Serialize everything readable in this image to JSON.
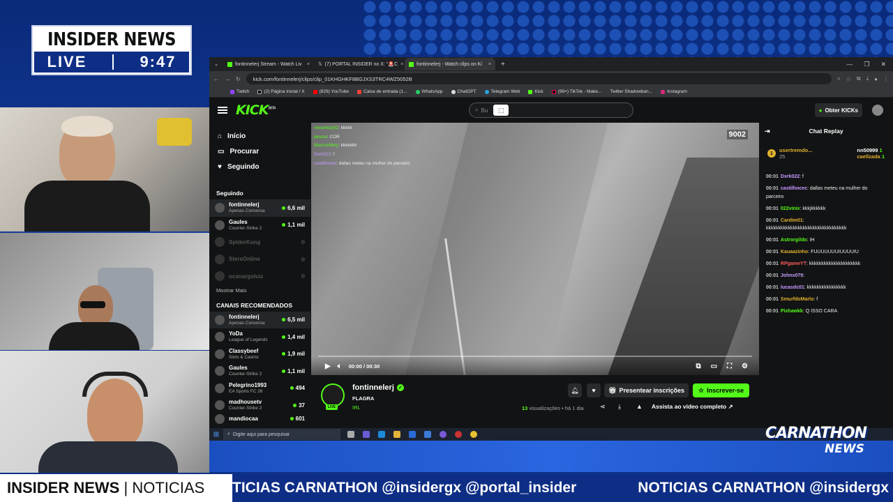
{
  "badge": {
    "title": "INSIDER NEWS",
    "live": "LIVE",
    "time": "9:47"
  },
  "browser": {
    "tabs": [
      {
        "label": "fontinnelerj Stream - Watch Liv",
        "close": "×"
      },
      {
        "label": "(7) PORTAL INSIDER no X: \"🚨C",
        "close": "×"
      },
      {
        "label": "fontinnelerj - Watch clips on Ki",
        "close": "×"
      }
    ],
    "new_tab": "+",
    "url": "kick.com/fontinnelerj/clips/clip_01KHGHKF8BGJXS3TRC4WZ5052B",
    "bookmarks": [
      "Twitch",
      "(2) Página Inicial / X",
      "(829) YouTube",
      "Caixa de entrada (1...",
      "WhatsApp",
      "ChatGPT",
      "Telegram Web",
      "Kick",
      "(99+) TikTok - Make...",
      "Twitter Shadowban...",
      "Instagram"
    ]
  },
  "kick": {
    "logo": "KICK",
    "logo_sup": "BETA",
    "search_placeholder": "Bu",
    "get_kicks": "Obter KICKs",
    "nav": [
      {
        "label": "Início",
        "icon": "home-icon"
      },
      {
        "label": "Procurar",
        "icon": "browse-icon"
      },
      {
        "label": "Seguindo",
        "icon": "heart-icon"
      }
    ],
    "following_title": "Seguindo",
    "following": [
      {
        "name": "fontinnelerj",
        "cat": "Apenas Conversa",
        "viewers": "6,6 mil",
        "on": true
      },
      {
        "name": "Gaules",
        "cat": "Counter-Strike 2",
        "viewers": "1,1 mil",
        "on": true
      },
      {
        "name": "SpiderKong",
        "cat": "",
        "viewers": "",
        "on": false
      },
      {
        "name": "StereOnline",
        "cat": "",
        "viewers": "",
        "on": false
      },
      {
        "name": "ocanargoluiz",
        "cat": "",
        "viewers": "",
        "on": false
      }
    ],
    "show_more": "Mostrar Mais",
    "recommended_title": "CANAIS RECOMENDADOS",
    "recommended": [
      {
        "name": "fontinnelerj",
        "cat": "Apenas Conversa",
        "viewers": "6,5 mil"
      },
      {
        "name": "YoDa",
        "cat": "League of Legends",
        "viewers": "1,4 mil"
      },
      {
        "name": "Classybeef",
        "cat": "Slots & Casino",
        "viewers": "1,9 mil"
      },
      {
        "name": "Gaules",
        "cat": "Counter-Strike 2",
        "viewers": "1,1 mil"
      },
      {
        "name": "Pelegrino1993",
        "cat": "EA Sports FC 26",
        "viewers": "494"
      },
      {
        "name": "madhousetv",
        "cat": "Counter-Strike 2",
        "viewers": "37"
      },
      {
        "name": "mandiocaa",
        "cat": "",
        "viewers": "601"
      }
    ],
    "video": {
      "viewer_count": "9002",
      "time": "00:00 / 00:30",
      "progress": 0,
      "overlay_chat": [
        {
          "user": "vincentarj02",
          "text": ": kkkkk"
        },
        {
          "user": "jaoxsa",
          "text": ": COR"
        },
        {
          "user": "MarcosNery",
          "text": ": kkkkkkk"
        },
        {
          "user": "Dxrk022",
          "text": ": f"
        },
        {
          "user": "castilhocec",
          "text": ": dallas meteu na mulher do parceiro"
        }
      ]
    },
    "channel": {
      "name": "fontinnelerj",
      "title": "FLAGRA",
      "category": "IRL",
      "live": "LIVE",
      "gift_label": "Presentear inscrições",
      "sub_label": "Inscrever-se",
      "views_count": "13",
      "views_label": "visualizações",
      "ago": "• há 1 dia",
      "full_video": "Assista ao vídeo completo"
    },
    "chat": {
      "title": "Chat Replay",
      "leader1": {
        "rank": "1",
        "name": "usertremdo...",
        "score": "25"
      },
      "leader2": {
        "name": "nn50999",
        "score": "1"
      },
      "leader3": {
        "name": "caellzada",
        "score": "1"
      },
      "messages": [
        {
          "t": "00:01",
          "u": "Dxrk022",
          "c": "#c79bff",
          "m": ": f"
        },
        {
          "t": "00:01",
          "u": "castilhocec",
          "c": "#c79bff",
          "m": ": dallas meteu na mulher do parceiro"
        },
        {
          "t": "00:01",
          "u": "022vinix",
          "c": "#53fc18",
          "m": ": kkkjkkkkkk"
        },
        {
          "t": "00:01",
          "u": "Cardim01",
          "c": "#e0b030",
          "m": ": kkkkkkkkkkkkkkkkkkkkkkkkkkkkkkkkk"
        },
        {
          "t": "00:01",
          "u": "Astrorgildo",
          "c": "#53fc18",
          "m": ": IH"
        },
        {
          "t": "00:01",
          "u": "Kauaazinho",
          "c": "#e0b030",
          "m": ": FUUUUUUUIUUUUIU"
        },
        {
          "t": "00:01",
          "u": "RPgameYT",
          "c": "#ff5a5a",
          "m": ": kkkkkkkkkkkkkkkkkkkkk"
        },
        {
          "t": "00:01",
          "u": "Johnx079",
          "c": "#c79bff",
          "m": ":"
        },
        {
          "t": "00:01",
          "u": "lucasdc01",
          "c": "#c79bff",
          "m": ": kkkkkkkkkkkkkkkk"
        },
        {
          "t": "00:01",
          "u": "SmurfdoMarlo",
          "c": "#e0b030",
          "m": ": f"
        },
        {
          "t": "00:01",
          "u": "Pixhawkk",
          "c": "#53fc18",
          "m": ": Q ISSO CARA"
        }
      ]
    }
  },
  "taskbar": {
    "search": "Digite aqui para pesquisar"
  },
  "carnathon": {
    "title": "CARNATHON",
    "sub": "NEWS"
  },
  "ticker": {
    "label_bold": "INSIDER NEWS",
    "label_sep": " | ",
    "label_rest": "NOTICIAS",
    "text1": "TICIAS CARNATHON @insidergx @portal_insider",
    "text2": "NOTICIAS CARNATHON @insidergx @portal_insider"
  }
}
